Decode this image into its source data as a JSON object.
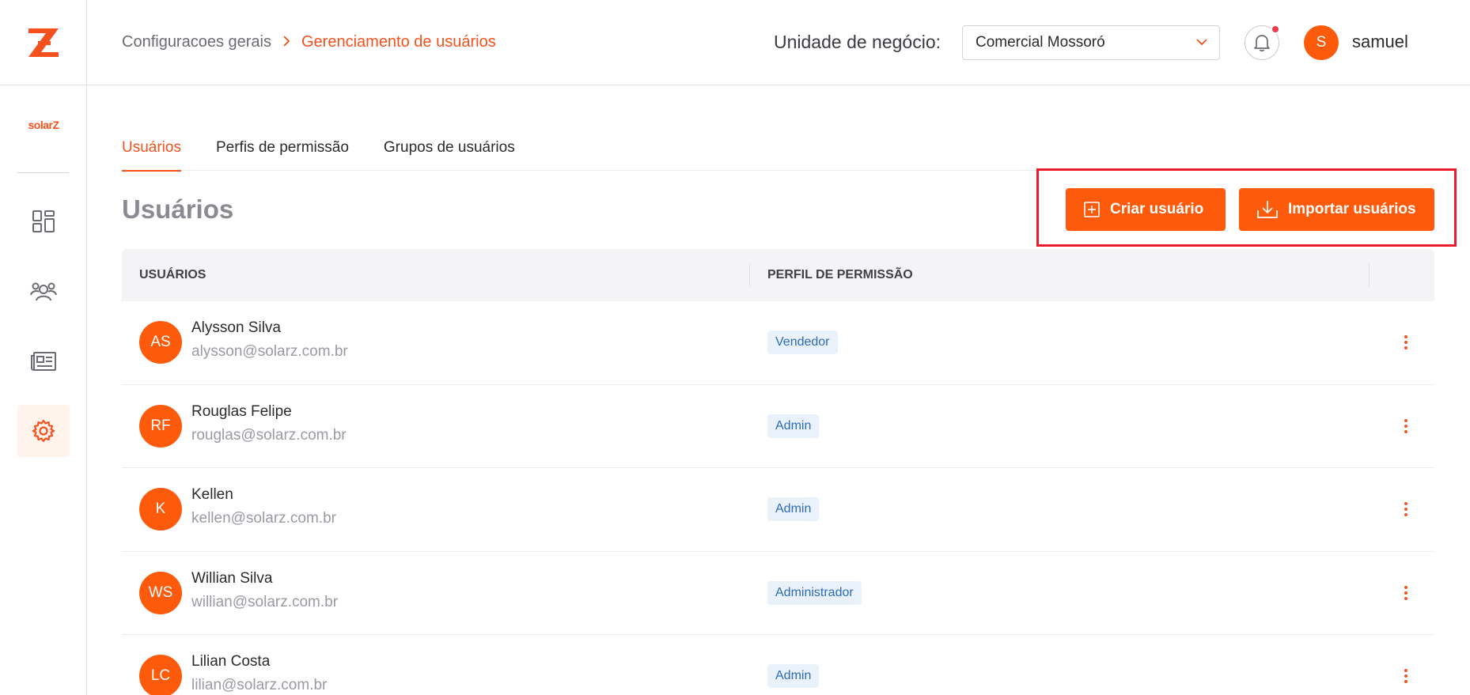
{
  "sidebar": {
    "brand_small": "solarZ",
    "items": [
      {
        "icon": "dashboard-icon"
      },
      {
        "icon": "users-group-icon"
      },
      {
        "icon": "newspaper-icon"
      },
      {
        "icon": "gear-icon",
        "active": true
      }
    ]
  },
  "header": {
    "breadcrumb": [
      "Configuracoes gerais",
      "Gerenciamento de usuários"
    ],
    "business_unit_label": "Unidade de negócio:",
    "business_unit_value": "Comercial Mossoró",
    "user_initial": "S",
    "user_name": "samuel"
  },
  "tabs": [
    {
      "label": "Usuários",
      "active": true
    },
    {
      "label": "Perfis de permissão"
    },
    {
      "label": "Grupos de usuários"
    }
  ],
  "page_title": "Usuários",
  "actions": {
    "create_label": "Criar usuário",
    "import_label": "Importar usuários"
  },
  "table": {
    "columns": [
      "USUÁRIOS",
      "PERFIL DE PERMISSÃO"
    ],
    "rows": [
      {
        "initials": "AS",
        "name": "Alysson Silva",
        "email": "alysson@solarz.com.br",
        "profile": "Vendedor"
      },
      {
        "initials": "RF",
        "name": "Rouglas Felipe",
        "email": "rouglas@solarz.com.br",
        "profile": "Admin"
      },
      {
        "initials": "K",
        "name": "Kellen",
        "email": "kellen@solarz.com.br",
        "profile": "Admin"
      },
      {
        "initials": "WS",
        "name": "Willian Silva",
        "email": "willian@solarz.com.br",
        "profile": "Administrador"
      },
      {
        "initials": "LC",
        "name": "Lilian Costa",
        "email": "lilian@solarz.com.br",
        "profile": "Admin"
      }
    ]
  },
  "colors": {
    "accent": "#fe5a0b",
    "accent_text": "#f4511e",
    "badge_bg": "#e9f2fb",
    "badge_text": "#2d6bb5",
    "highlight": "#ee1c2a"
  }
}
